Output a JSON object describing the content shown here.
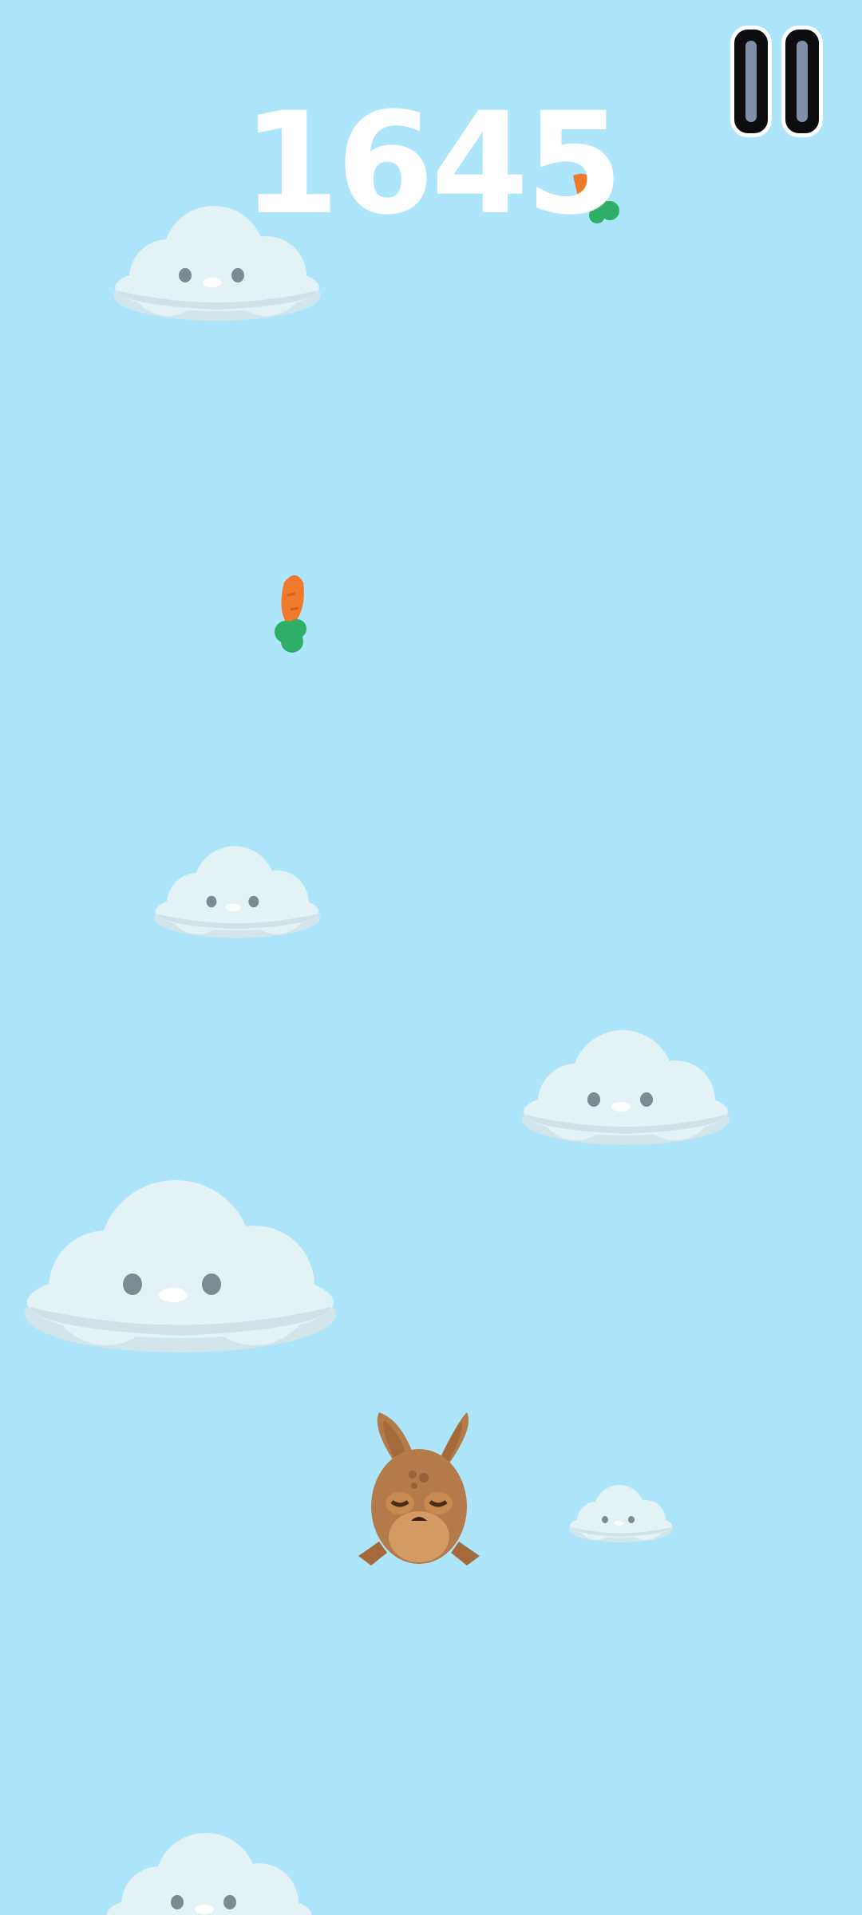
{
  "hud": {
    "score": "1645",
    "pause_icon": "pause-icon"
  },
  "scene": {
    "sky_color": "#ade5fb",
    "cloud_color": "#e2f2f5",
    "carrot_color": "#ef7a2c",
    "leaf_color": "#2fae67",
    "bunny_color": "#b57a49"
  }
}
